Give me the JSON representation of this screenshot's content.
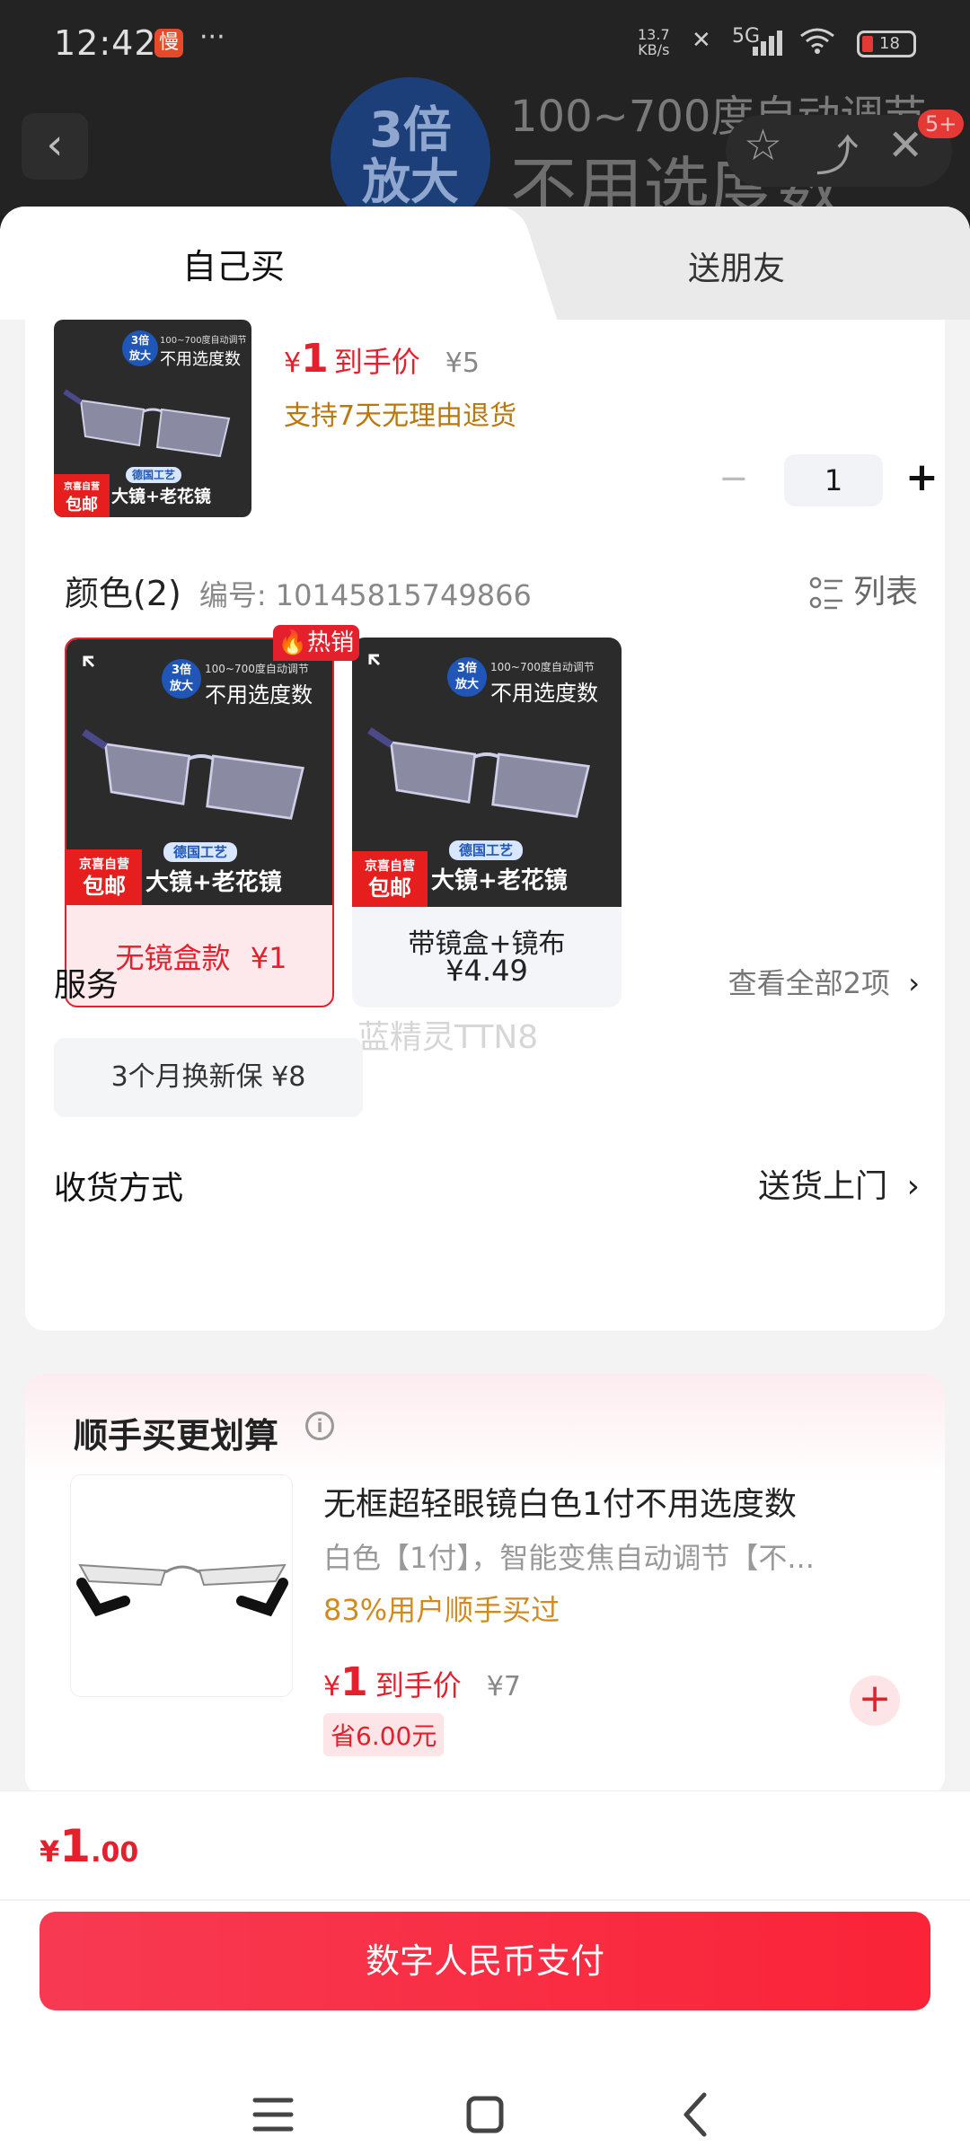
{
  "status_bar": {
    "time": "12:42",
    "app_badge": "慢",
    "more": "···",
    "net_speed_value": "13.7",
    "net_speed_unit": "KB/s",
    "network": "5G",
    "battery": "18"
  },
  "background": {
    "promo_circle_line1": "3倍",
    "promo_circle_line2": "放大",
    "promo_text1": "100~700度自动调节",
    "promo_text2": "不用选度数",
    "badge": "5+"
  },
  "tabs": [
    {
      "label": "自己买",
      "active": true
    },
    {
      "label": "送朋友",
      "active": false
    }
  ],
  "product": {
    "thumb": {
      "circle1": "3倍",
      "circle2": "放大",
      "line1": "100~700度自动调节",
      "line2": "不用选度数",
      "craft": "德国工艺",
      "tagline": "大镜+老花镜",
      "jd1": "京喜自营",
      "jd2": "包邮"
    },
    "price_symbol": "¥",
    "price": "1",
    "price_label": "到手价",
    "original_price": "¥5",
    "support": "支持7天无理由退货",
    "minus": "−",
    "quantity": "1",
    "plus": "+"
  },
  "colors": {
    "title": "颜色(2)",
    "code_label": "编号: 10145815749866",
    "list_label": "列表",
    "hot_label": "热销",
    "options": [
      {
        "label": "无镜盒款",
        "price": "¥1",
        "selected": true
      },
      {
        "label": "带镜盒+镜布",
        "price": "¥4.49",
        "selected": false
      }
    ]
  },
  "watermark": "蓝精灵TTN8",
  "service": {
    "title": "服务",
    "view_all": "查看全部2项",
    "chip": "3个月换新保  ¥8"
  },
  "delivery": {
    "title": "收货方式",
    "value": "送货上门"
  },
  "addon": {
    "title": "顺手买更划算",
    "info": "i",
    "name": "无框超轻眼镜白色1付不用选度数",
    "desc": "白色【1付】，智能变焦自动调节【不...",
    "popularity": "83%用户顺手买过",
    "price_symbol": "¥",
    "price": "1",
    "price_label": "到手价",
    "original_price": "¥7",
    "save": "省6.00元",
    "add": "+"
  },
  "bottom": {
    "total_symbol": "¥",
    "total_int": "1",
    "total_dec": ".00",
    "pay_label": "数字人民币支付"
  },
  "colors_theme": {
    "accent_red": "#e4202c",
    "pay_gradient_start": "#f73a52",
    "pay_gradient_end": "#fa2337",
    "support_orange": "#b9770e"
  }
}
